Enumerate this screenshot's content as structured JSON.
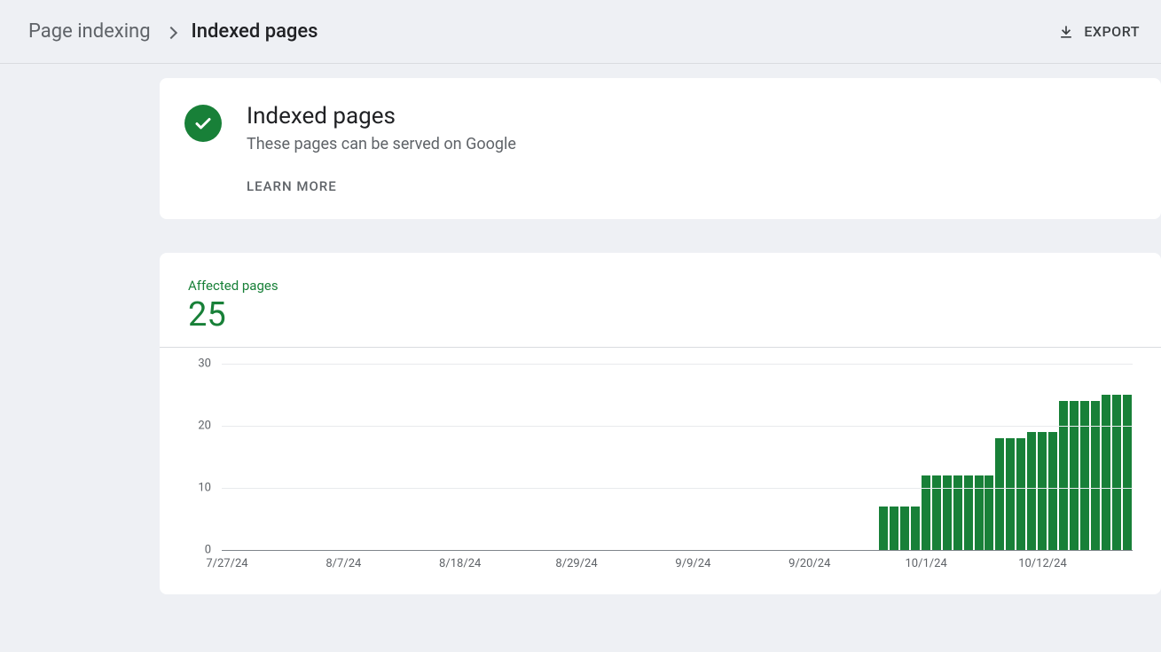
{
  "header": {
    "breadcrumb_parent": "Page indexing",
    "breadcrumb_current": "Indexed pages",
    "export_label": "EXPORT"
  },
  "summary": {
    "title": "Indexed pages",
    "subtitle": "These pages can be served on Google",
    "learn_more": "LEARN MORE"
  },
  "metric": {
    "label": "Affected pages",
    "value": "25"
  },
  "chart_data": {
    "type": "bar",
    "title": "Affected pages",
    "ylabel": "",
    "xlabel": "",
    "ylim": [
      0,
      30
    ],
    "y_ticks": [
      0,
      10,
      20,
      30
    ],
    "x_tick_labels": [
      "7/27/24",
      "8/7/24",
      "8/18/24",
      "8/29/24",
      "9/9/24",
      "9/20/24",
      "10/1/24",
      "10/12/24"
    ],
    "categories": [
      "7/27/24",
      "7/28/24",
      "7/29/24",
      "7/30/24",
      "7/31/24",
      "8/1/24",
      "8/2/24",
      "8/3/24",
      "8/4/24",
      "8/5/24",
      "8/6/24",
      "8/7/24",
      "8/8/24",
      "8/9/24",
      "8/10/24",
      "8/11/24",
      "8/12/24",
      "8/13/24",
      "8/14/24",
      "8/15/24",
      "8/16/24",
      "8/17/24",
      "8/18/24",
      "8/19/24",
      "8/20/24",
      "8/21/24",
      "8/22/24",
      "8/23/24",
      "8/24/24",
      "8/25/24",
      "8/26/24",
      "8/27/24",
      "8/28/24",
      "8/29/24",
      "8/30/24",
      "8/31/24",
      "9/1/24",
      "9/2/24",
      "9/3/24",
      "9/4/24",
      "9/5/24",
      "9/6/24",
      "9/7/24",
      "9/8/24",
      "9/9/24",
      "9/10/24",
      "9/11/24",
      "9/12/24",
      "9/13/24",
      "9/14/24",
      "9/15/24",
      "9/16/24",
      "9/17/24",
      "9/18/24",
      "9/19/24",
      "9/20/24",
      "9/21/24",
      "9/22/24",
      "9/23/24",
      "9/24/24",
      "9/25/24",
      "9/26/24",
      "9/27/24",
      "9/28/24",
      "9/29/24",
      "9/30/24",
      "10/1/24",
      "10/2/24",
      "10/3/24",
      "10/4/24",
      "10/5/24",
      "10/6/24",
      "10/7/24",
      "10/8/24",
      "10/9/24",
      "10/10/24",
      "10/11/24",
      "10/12/24",
      "10/13/24",
      "10/14/24",
      "10/15/24",
      "10/16/24",
      "10/17/24",
      "10/18/24",
      "10/19/24",
      "10/20/24"
    ],
    "values": [
      0,
      0,
      0,
      0,
      0,
      0,
      0,
      0,
      0,
      0,
      0,
      0,
      0,
      0,
      0,
      0,
      0,
      0,
      0,
      0,
      0,
      0,
      0,
      0,
      0,
      0,
      0,
      0,
      0,
      0,
      0,
      0,
      0,
      0,
      0,
      0,
      0,
      0,
      0,
      0,
      0,
      0,
      0,
      0,
      0,
      0,
      0,
      0,
      0,
      0,
      0,
      0,
      0,
      0,
      0,
      0,
      0,
      0,
      0,
      0,
      0,
      0,
      7,
      7,
      7,
      7,
      12,
      12,
      12,
      12,
      12,
      12,
      12,
      18,
      18,
      18,
      19,
      19,
      19,
      24,
      24,
      24,
      24,
      25,
      25,
      25
    ],
    "color": "#188038"
  }
}
